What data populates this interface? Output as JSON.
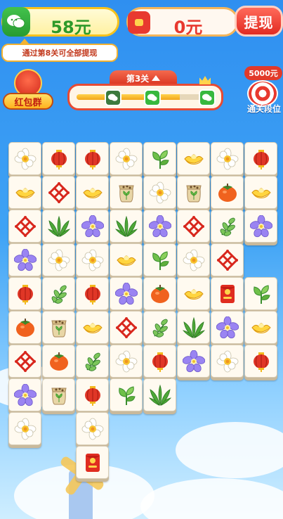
{
  "header": {
    "balance": "58元",
    "red_packet_balance": "0元",
    "withdraw_label": "提现",
    "withdraw_hint": "通过第8关可全部提现"
  },
  "side": {
    "group_label": "红包群",
    "reward_amount": "5000元",
    "reward_label": "通关段位"
  },
  "level": {
    "label": "第3关",
    "progress": 0.75
  },
  "tile_icons": {
    "F": "narcissus-flower",
    "L": "red-lantern",
    "P": "green-plant-sprout",
    "G": "gold-ingot",
    "K": "chinese-knot",
    "S": "seed-bag",
    "O": "persimmon",
    "V": "purple-flower",
    "A": "aloe-plant",
    "E": "herb-leaves",
    "R": "red-envelope"
  },
  "board": {
    "rows": [
      "FLLFPGFL",
      "GKGSFSOG",
      "KAVAVKEV",
      "VFFGPFK",
      "LELVOGRP",
      "OSGKEAVG",
      "KOEFLVFL",
      "VSLPA",
      "F_F",
      "__R"
    ]
  }
}
